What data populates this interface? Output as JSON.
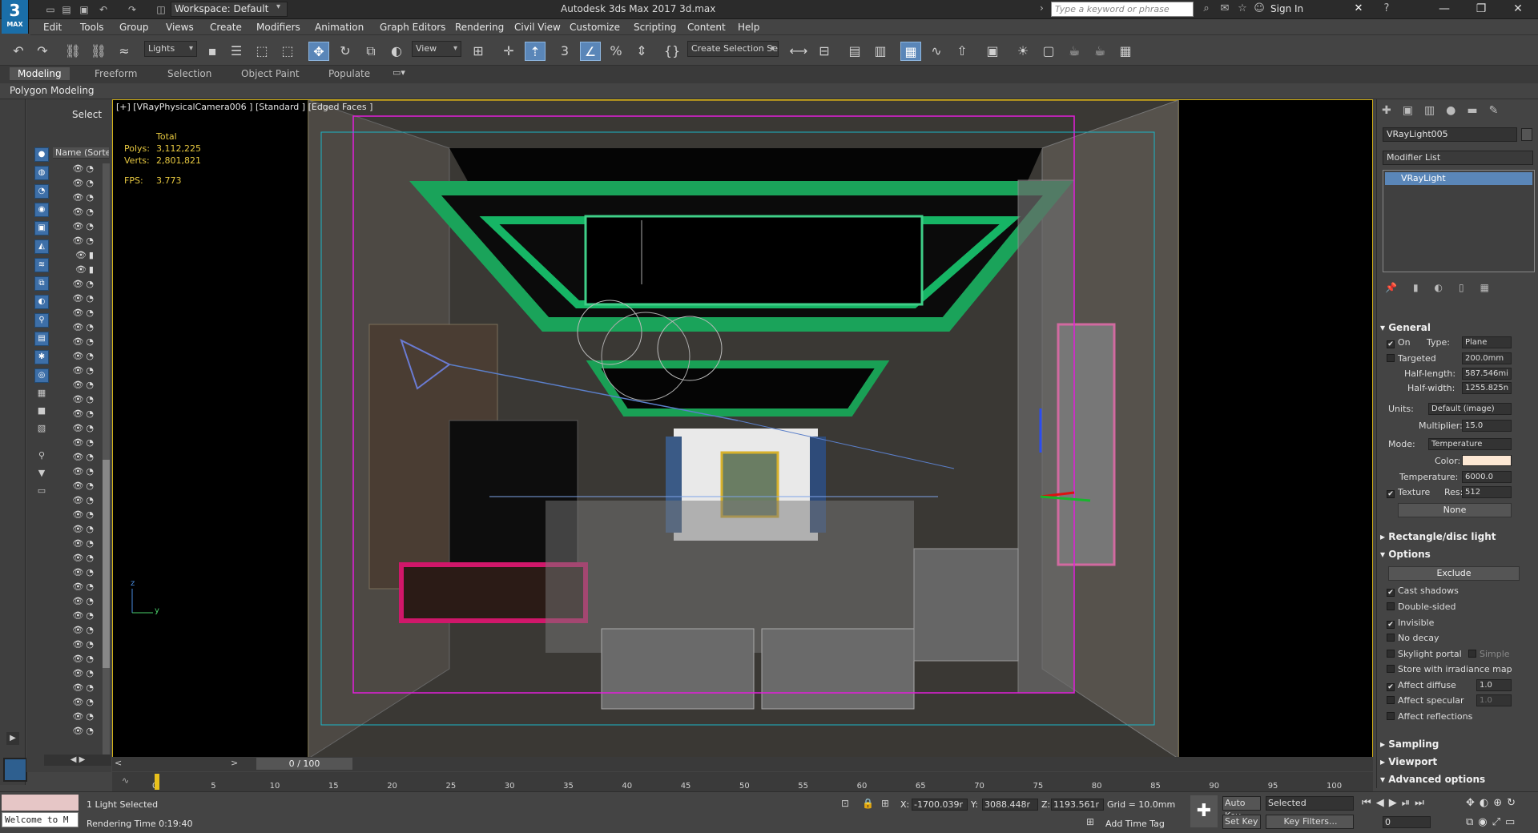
{
  "titlebar": {
    "logo_big": "3",
    "logo_small": "MAX",
    "workspace": "Workspace: Default",
    "title": "Autodesk 3ds Max 2017    3d.max",
    "search_placeholder": "Type a keyword or phrase",
    "sign_in": "Sign In"
  },
  "menu": [
    "Edit",
    "Tools",
    "Group",
    "Views",
    "Create",
    "Modifiers",
    "Animation",
    "Graph Editors",
    "Rendering",
    "Civil View",
    "Customize",
    "Scripting",
    "Content",
    "Help"
  ],
  "toolbar": {
    "filter": "Lights",
    "view": "View",
    "selection_set": "Create Selection Se"
  },
  "ribbon": {
    "tabs": [
      "Modeling",
      "Freeform",
      "Selection",
      "Object Paint",
      "Populate"
    ],
    "panel": "Polygon Modeling"
  },
  "scene": {
    "select": "Select",
    "name_header": "Name (Sorted"
  },
  "viewport": {
    "label": "[+] [VRayPhysicalCamera006 ] [Standard ] [Edged Faces ]",
    "total": "Total",
    "polys_lbl": "Polys:",
    "polys": "3,112,225",
    "verts_lbl": "Verts:",
    "verts": "2,801,821",
    "fps_lbl": "FPS:",
    "fps": "3.773",
    "axis_z": "z",
    "axis_y": "y"
  },
  "cmd": {
    "object_name": "VRayLight005",
    "modifier_list": "Modifier List",
    "stack_item": "VRayLight",
    "general": "General",
    "on": "On",
    "type_lbl": "Type:",
    "type": "Plane",
    "targeted": "Targeted",
    "targeted_val": "200.0mm",
    "half_length_lbl": "Half-length:",
    "half_length": "587.546mi",
    "half_width_lbl": "Half-width:",
    "half_width": "1255.825n",
    "units_lbl": "Units:",
    "units": "Default (image)",
    "multiplier_lbl": "Multiplier:",
    "multiplier": "15.0",
    "mode_lbl": "Mode:",
    "mode": "Temperature",
    "color_lbl": "Color:",
    "color": "#fde8d4",
    "temperature_lbl": "Temperature:",
    "temperature": "6000.0",
    "texture": "Texture",
    "res_lbl": "Res:",
    "res": "512",
    "none": "None",
    "rect_disc": "Rectangle/disc light",
    "options": "Options",
    "exclude": "Exclude",
    "cast_shadows": "Cast shadows",
    "double_sided": "Double-sided",
    "invisible": "Invisible",
    "no_decay": "No decay",
    "skylight_portal": "Skylight portal",
    "simple": "Simple",
    "store_irradiance": "Store with irradiance map",
    "affect_diffuse": "Affect diffuse",
    "affect_diffuse_val": "1.0",
    "affect_specular": "Affect specular",
    "affect_specular_val": "1.0",
    "affect_reflections": "Affect reflections",
    "sampling": "Sampling",
    "viewport": "Viewport",
    "advanced": "Advanced options"
  },
  "timeline": {
    "frame": "0 / 100",
    "ticks": [
      "0",
      "5",
      "10",
      "15",
      "20",
      "25",
      "30",
      "35",
      "40",
      "45",
      "50",
      "55",
      "60",
      "65",
      "70",
      "75",
      "80",
      "85",
      "90",
      "95",
      "100"
    ]
  },
  "status": {
    "welcome": "Welcome to M",
    "selected": "1 Light Selected",
    "render_time": "Rendering Time  0:19:40",
    "x_lbl": "X:",
    "x": "-1700.039r",
    "y_lbl": "Y:",
    "y": "3088.448r",
    "z_lbl": "Z:",
    "z": "1193.561r",
    "grid": "Grid = 10.0mm",
    "add_time_tag": "Add Time Tag",
    "auto_key": "Auto Key",
    "selected_dd": "Selected",
    "set_key": "Set Key",
    "key_filters": "Key Filters...",
    "frame_field": "0"
  }
}
